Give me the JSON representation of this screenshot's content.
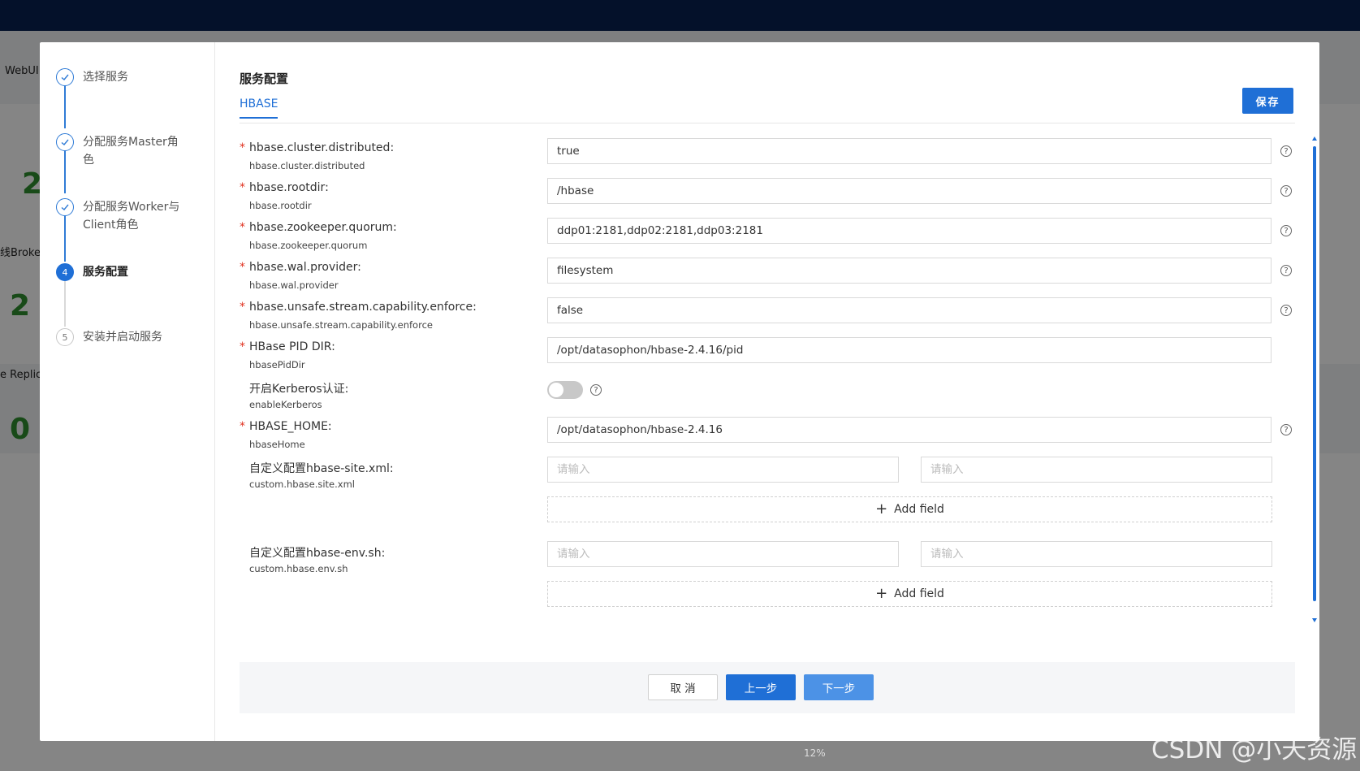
{
  "background": {
    "webui_label": "WebUI",
    "numbers": [
      "2",
      "2",
      "0"
    ],
    "labels": [
      "线Broke",
      "e Replic"
    ],
    "axis_pct": "12%"
  },
  "steps": [
    {
      "label": "选择服务",
      "state": "done",
      "icon": "check-icon"
    },
    {
      "label": "分配服务Master角色",
      "state": "done",
      "icon": "check-icon"
    },
    {
      "label": "分配服务Worker与Client角色",
      "state": "done",
      "icon": "check-icon"
    },
    {
      "label": "服务配置",
      "state": "active",
      "number": "4"
    },
    {
      "label": "安装并启动服务",
      "state": "wait",
      "number": "5"
    }
  ],
  "content": {
    "title": "服务配置",
    "tab": "HBASE",
    "save_label": "保存"
  },
  "fields": [
    {
      "label": "hbase.cluster.distributed",
      "key": "hbase.cluster.distributed",
      "value": "true",
      "required": true
    },
    {
      "label": "hbase.rootdir",
      "key": "hbase.rootdir",
      "value": "/hbase",
      "required": true
    },
    {
      "label": "hbase.zookeeper.quorum",
      "key": "hbase.zookeeper.quorum",
      "value": "ddp01:2181,ddp02:2181,ddp03:2181",
      "required": true
    },
    {
      "label": "hbase.wal.provider",
      "key": "hbase.wal.provider",
      "value": "filesystem",
      "required": true
    },
    {
      "label": "hbase.unsafe.stream.capability.enforce",
      "key": "hbase.unsafe.stream.capability.enforce",
      "value": "false",
      "required": true
    },
    {
      "label": "HBase PID DIR",
      "key": "hbasePidDir",
      "value": "/opt/datasophon/hbase-2.4.16/pid",
      "required": true
    },
    {
      "label": "开启Kerberos认证",
      "key": "enableKerberos",
      "toggle": false,
      "required": false
    },
    {
      "label": "HBASE_HOME",
      "key": "hbaseHome",
      "value": "/opt/datasophon/hbase-2.4.16",
      "required": true
    },
    {
      "label": "自定义配置hbase-site.xml",
      "key": "custom.hbase.site.xml",
      "placeholder": "请输入",
      "add_field": "Add field"
    },
    {
      "label": "自定义配置hbase-env.sh",
      "key": "custom.hbase.env.sh",
      "placeholder": "请输入",
      "add_field": "Add field"
    }
  ],
  "help_symbol": "?",
  "required_mark": "*",
  "label_suffix": ":",
  "footer": {
    "cancel": "取 消",
    "prev": "上一步",
    "next": "下一步"
  },
  "watermark": "CSDN @小天资源",
  "colors": {
    "primary": "#1f6fd6",
    "required": "#e0301e",
    "topbar": "#04112a"
  }
}
